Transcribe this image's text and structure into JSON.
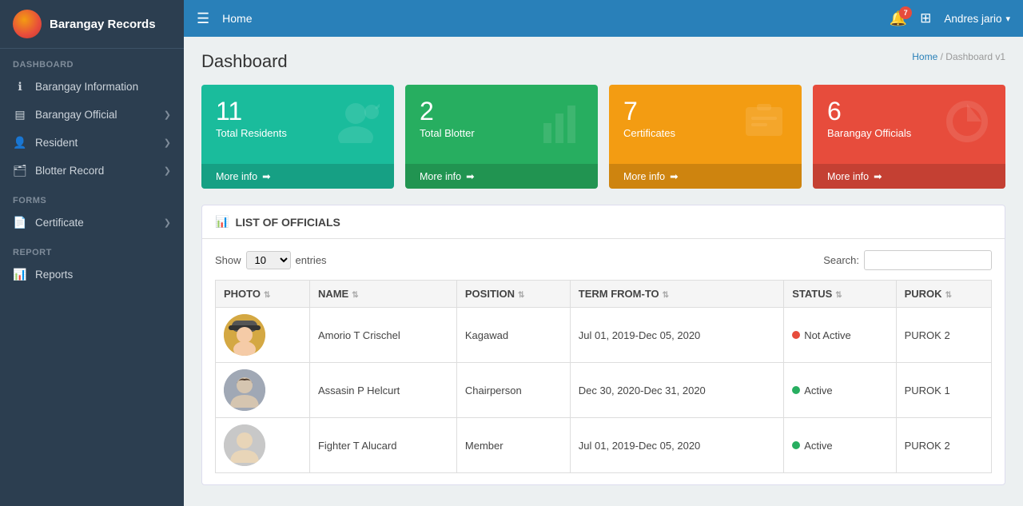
{
  "app": {
    "name": "Barangay Records"
  },
  "topbar": {
    "home_label": "Home",
    "user_name": "Andres jario",
    "notification_count": "7"
  },
  "breadcrumb": {
    "home": "Home",
    "current": "Dashboard v1"
  },
  "dashboard": {
    "title": "Dashboard"
  },
  "cards": [
    {
      "id": "total-residents",
      "number": "11",
      "label": "Total Residents",
      "more_info": "More info",
      "color_class": "info-card-teal",
      "icon": "👤"
    },
    {
      "id": "total-blotter",
      "number": "2",
      "label": "Total Blotter",
      "more_info": "More info",
      "color_class": "info-card-green",
      "icon": "📊"
    },
    {
      "id": "certificates",
      "number": "7",
      "label": "Certificates",
      "more_info": "More info",
      "color_class": "info-card-yellow",
      "icon": "📁"
    },
    {
      "id": "barangay-officials",
      "number": "6",
      "label": "Barangay Officials",
      "more_info": "More info",
      "color_class": "info-card-red",
      "icon": "🍩"
    }
  ],
  "officials_panel": {
    "title": "LIST OF OFFICIALS",
    "show_label": "Show",
    "entries_label": "entries",
    "search_label": "Search:",
    "entries_value": "10",
    "columns": [
      "PHOTO",
      "NAME",
      "POSITION",
      "TERM FROM-TO",
      "STATUS",
      "PUROK"
    ],
    "rows": [
      {
        "avatar_type": "person1",
        "name": "Amorio T Crischel",
        "position": "Kagawad",
        "term": "Jul 01, 2019-Dec 05, 2020",
        "status": "Not Active",
        "status_color": "dot-red",
        "purok": "PUROK 2"
      },
      {
        "avatar_type": "person2",
        "name": "Assasin P Helcurt",
        "position": "Chairperson",
        "term": "Dec 30, 2020-Dec 31, 2020",
        "status": "Active",
        "status_color": "dot-green",
        "purok": "PUROK 1"
      },
      {
        "avatar_type": "person3",
        "name": "Fighter T Alucard",
        "position": "Member",
        "term": "Jul 01, 2019-Dec 05, 2020",
        "status": "Active",
        "status_color": "dot-green",
        "purok": "PUROK 2"
      }
    ]
  },
  "sidebar": {
    "sections": [
      {
        "label": "DASHBOARD",
        "items": [
          {
            "id": "barangay-information",
            "icon": "ℹ",
            "label": "Barangay Information",
            "has_chevron": false
          },
          {
            "id": "barangay-official",
            "icon": "📋",
            "label": "Barangay Official",
            "has_chevron": true
          },
          {
            "id": "resident",
            "icon": "👤",
            "label": "Resident",
            "has_chevron": true
          },
          {
            "id": "blotter-record",
            "icon": "🗂",
            "label": "Blotter Record",
            "has_chevron": true
          }
        ]
      },
      {
        "label": "FORMS",
        "items": [
          {
            "id": "certificate",
            "icon": "📄",
            "label": "Certificate",
            "has_chevron": true
          }
        ]
      },
      {
        "label": "REPORT",
        "items": [
          {
            "id": "reports",
            "icon": "📊",
            "label": "Reports",
            "has_chevron": false
          }
        ]
      }
    ]
  }
}
